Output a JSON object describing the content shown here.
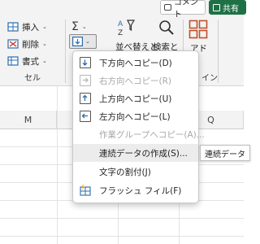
{
  "topbar": {
    "comment_label": "コメント",
    "share_label": "共有"
  },
  "cells_group": {
    "insert_label": "挿入",
    "delete_label": "削除",
    "format_label": "書式",
    "group_label": "セル"
  },
  "editing_group": {
    "autosum_icon": "sigma-icon",
    "fill_icon": "fill-down-icon",
    "sort_filter_label": "並べ替えと",
    "find_select_label": "検索と",
    "group_label_partial": "イン"
  },
  "addins": {
    "label_partial": "アド"
  },
  "columns": {
    "m": "M",
    "q": "Q"
  },
  "fill_menu": {
    "items": [
      {
        "label": "下方向へコピー(D)",
        "enabled": true,
        "icon": "arrow-down-icon"
      },
      {
        "label": "右方向へコピー(R)",
        "enabled": false,
        "icon": "arrow-right-icon"
      },
      {
        "label": "上方向へコピー(U)",
        "enabled": true,
        "icon": "arrow-up-icon"
      },
      {
        "label": "左方向へコピー(L)",
        "enabled": true,
        "icon": "arrow-left-icon"
      },
      {
        "label": "作業グループへコピー(A)...",
        "enabled": false,
        "icon": ""
      },
      {
        "label": "連続データの作成(S)...",
        "enabled": true,
        "icon": "",
        "highlighted": true
      },
      {
        "label": "文字の割付(J)",
        "enabled": true,
        "icon": ""
      },
      {
        "label": "フラッシュ フィル(F)",
        "enabled": true,
        "icon": "flash-fill-icon"
      }
    ]
  },
  "tooltip": {
    "text": "連続データ"
  },
  "colors": {
    "accent_blue": "#2b6cb0",
    "share_green": "#1e7145",
    "addin_orange": "#c0502a"
  }
}
